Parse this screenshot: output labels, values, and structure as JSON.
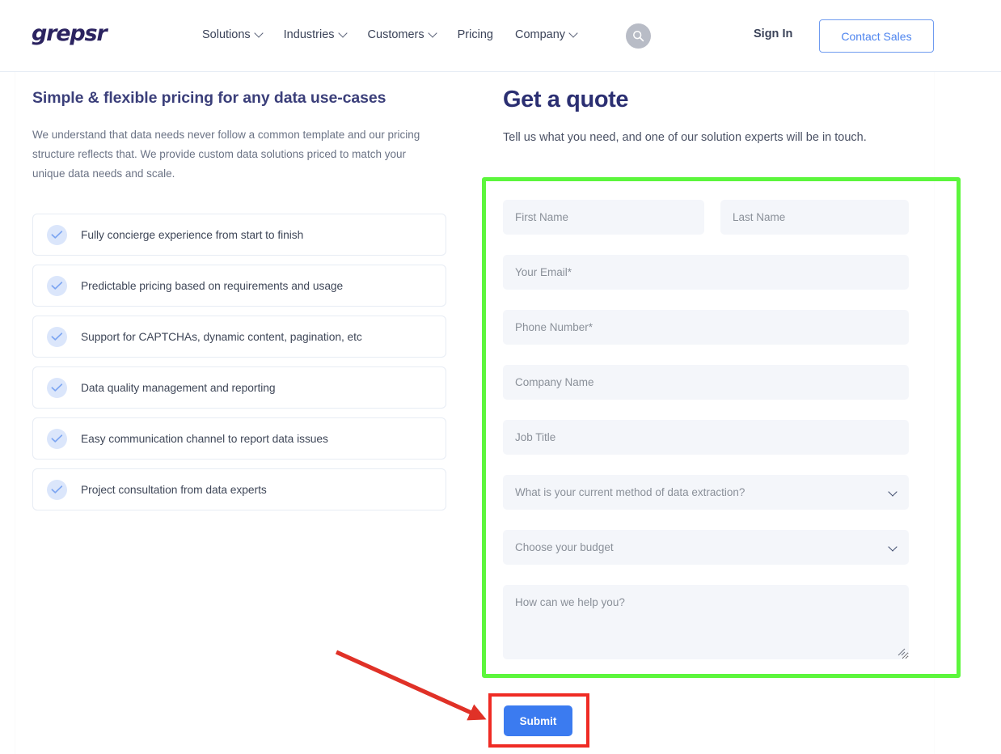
{
  "header": {
    "logo_text": "grepsr",
    "nav_items": [
      {
        "label": "Solutions",
        "has_caret": true
      },
      {
        "label": "Industries",
        "has_caret": true
      },
      {
        "label": "Customers",
        "has_caret": true
      },
      {
        "label": "Pricing",
        "has_caret": false
      },
      {
        "label": "Company",
        "has_caret": true
      }
    ],
    "search_icon": "search-icon",
    "sign_in_label": "Sign In",
    "contact_sales_label": "Contact Sales"
  },
  "left": {
    "title": "Simple & flexible pricing for any data use-cases",
    "description": "We understand that data needs never follow a common template and our pricing structure reflects that. We provide custom data solutions priced to match your unique data needs and scale.",
    "features": [
      {
        "label": "Fully concierge experience from start to finish",
        "icon": "check-circle-icon"
      },
      {
        "label": "Predictable pricing based on requirements and usage",
        "icon": "check-circle-icon"
      },
      {
        "label": "Support for CAPTCHAs, dynamic content, pagination, etc",
        "icon": "check-circle-icon"
      },
      {
        "label": "Data quality management and reporting",
        "icon": "check-circle-icon"
      },
      {
        "label": "Easy communication channel to report data issues",
        "icon": "check-circle-icon"
      },
      {
        "label": "Project consultation from data experts",
        "icon": "check-circle-icon"
      }
    ]
  },
  "form": {
    "title": "Get a quote",
    "subtitle": "Tell us what you need, and one of our solution experts will be in touch.",
    "first_name": {
      "placeholder": "First Name",
      "value": ""
    },
    "last_name": {
      "placeholder": "Last Name",
      "value": ""
    },
    "email": {
      "placeholder": "Your Email*",
      "value": ""
    },
    "phone": {
      "placeholder": "Phone Number*",
      "value": ""
    },
    "company": {
      "placeholder": "Company Name",
      "value": ""
    },
    "job_title": {
      "placeholder": "Job Title",
      "value": ""
    },
    "extraction_method": {
      "label": "What is your current method of data extraction?",
      "icon": "chevron-down-icon"
    },
    "budget": {
      "label": "Choose your budget",
      "icon": "chevron-down-icon"
    },
    "message": {
      "placeholder": "How can we help you?",
      "value": ""
    },
    "submit_label": "Submit"
  },
  "annotations": {
    "green_box_color": "#5cf63c",
    "red_box_color": "#ef2b24",
    "red_arrow_color": "#e03127"
  },
  "colors": {
    "brand_navy": "#2b2f72",
    "accent_blue": "#3b7bf0",
    "link_blue": "#4d84ef",
    "field_bg": "#f4f6fa",
    "text_muted": "#6b7385"
  }
}
